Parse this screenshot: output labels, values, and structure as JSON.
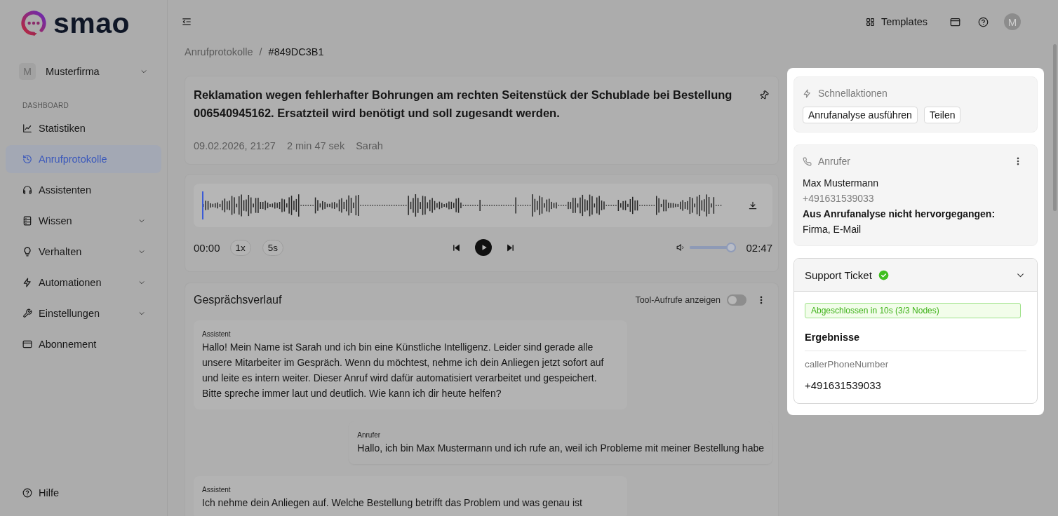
{
  "sidebar": {
    "logo": "smao",
    "workspace": {
      "initial": "M",
      "name": "Musterfirma",
      "expanded": false
    },
    "section_label": "DASHBOARD",
    "items": [
      {
        "label": "Statistiken",
        "selected": false
      },
      {
        "label": "Anrufprotokolle",
        "selected": true
      },
      {
        "label": "Assistenten",
        "selected": false
      },
      {
        "label": "Wissen",
        "selected": false,
        "expanded": false
      },
      {
        "label": "Verhalten",
        "selected": false,
        "expanded": false
      },
      {
        "label": "Automationen",
        "selected": false,
        "expanded": false
      },
      {
        "label": "Einstellungen",
        "selected": false,
        "expanded": false
      },
      {
        "label": "Abonnement",
        "selected": false
      }
    ],
    "footer_item": {
      "label": "Hilfe"
    }
  },
  "header": {
    "templates_label": "Templates",
    "avatar_initial": "M"
  },
  "breadcrumb": {
    "separator": "/",
    "items": [
      {
        "label": "Anrufprotokolle",
        "current": false
      },
      {
        "label": "#849DC3B1",
        "current": true
      }
    ]
  },
  "call": {
    "title": "Reklamation wegen fehlerhafter Bohrungen am rechten Seitenstück der Schublade bei Bestellung 006540945162. Ersatzteil wird benötigt und soll zugesandt werden.",
    "date": "09.02.2026, 21:27",
    "duration": "2 min 47 sek",
    "agent": "Sarah"
  },
  "player": {
    "level": 0,
    "current_time": "00:00",
    "speed": "1x",
    "skip": "5s",
    "volume": {
      "level": 0.9
    },
    "total_time": "02:47"
  },
  "conversation": {
    "title": "Gesprächsverlauf",
    "tool_calls": {
      "label": "Tool-Aufrufe anzeigen",
      "on": false
    },
    "messages": [
      {
        "kind": "assistant",
        "speaker": "Assistent",
        "text": "Hallo! Mein Name ist Sarah und ich bin eine Künstliche Intelligenz. Leider sind gerade alle unsere Mitarbeiter im Gespräch. Wenn du möchtest, nehme ich dein Anliegen jetzt sofort auf und leite es intern weiter. Dieser Anruf wird dafür automatisiert verarbeitet und gespeichert. Bitte spreche immer laut und deutlich. Wie kann ich dir heute helfen?"
      },
      {
        "kind": "caller",
        "speaker": "Anrufer",
        "text": "Hallo, ich bin Max Mustermann und ich rufe an, weil ich Probleme mit meiner Bestellung habe"
      },
      {
        "kind": "assistant",
        "speaker": "Assistent",
        "text": "Ich nehme dein Anliegen auf. Welche Bestellung betrifft das Problem und was genau ist"
      }
    ]
  },
  "side_panel": {
    "quick_actions": {
      "title": "Schnellaktionen",
      "buttons": [
        "Anrufanalyse ausführen",
        "Teilen"
      ]
    },
    "caller": {
      "title": "Anrufer",
      "name": "Max Mustermann",
      "phone": "+491631539033",
      "missing_label": "Aus Anrufanalyse nicht hervorgegangen:",
      "missing_fields": "Firma, E-Mail"
    },
    "ticket": {
      "title": "Support Ticket",
      "completed": true,
      "expanded": true,
      "status_badge": "Abgeschlossen in 10s (3/3 Nodes)",
      "results_heading": "Ergebnisse",
      "results": [
        {
          "key": "callerPhoneNumber",
          "value": "+491631539033"
        }
      ]
    }
  }
}
